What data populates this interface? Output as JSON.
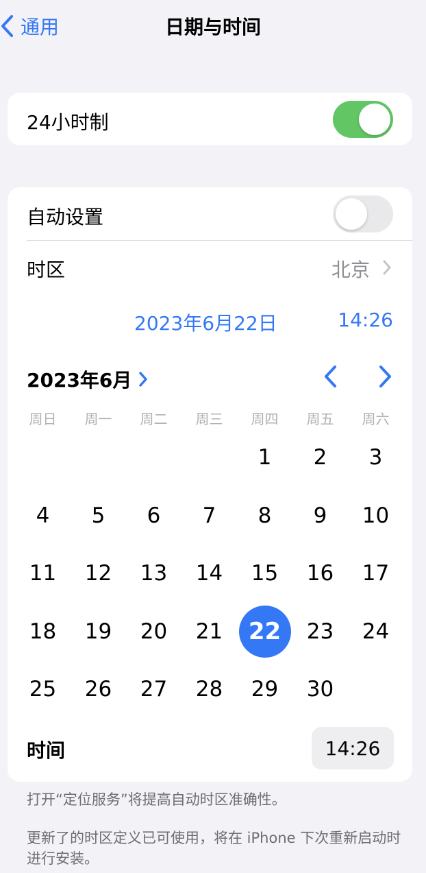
{
  "nav": {
    "back_label": "通用",
    "title": "日期与时间"
  },
  "format_card": {
    "label": "24小时制",
    "toggle_state": "on"
  },
  "settings": {
    "auto_set_label": "自动设置",
    "auto_set_state": "off",
    "timezone_label": "时区",
    "timezone_value": "北京",
    "selected_date": "2023年6月22日",
    "selected_time": "14:26"
  },
  "calendar": {
    "month_label": "2023年6月",
    "weekdays": [
      "周日",
      "周一",
      "周二",
      "周三",
      "周四",
      "周五",
      "周六"
    ],
    "leading_blanks": 4,
    "days": [
      "1",
      "2",
      "3",
      "4",
      "5",
      "6",
      "7",
      "8",
      "9",
      "10",
      "11",
      "12",
      "13",
      "14",
      "15",
      "16",
      "17",
      "18",
      "19",
      "20",
      "21",
      "22",
      "23",
      "24",
      "25",
      "26",
      "27",
      "28",
      "29",
      "30"
    ],
    "selected_day": "22"
  },
  "time_row": {
    "label": "时间",
    "value": "14:26"
  },
  "footnotes": {
    "location": "打开“定位服务”将提高自动时区准确性。",
    "update": "更新了的时区定义已可使用，将在 iPhone 下次重新启动时进行安装。"
  },
  "colors": {
    "accent": "#3478f6",
    "toggle_on": "#63c664",
    "background": "#f2f2f7"
  }
}
